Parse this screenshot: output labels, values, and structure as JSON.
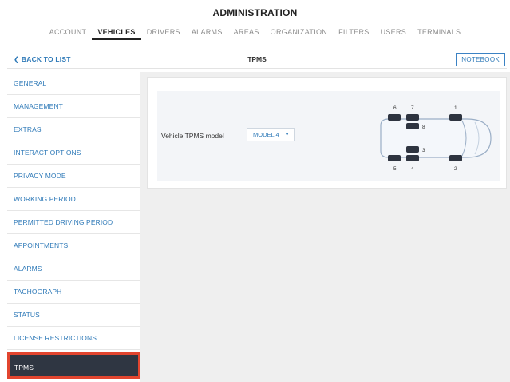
{
  "header": {
    "title": "ADMINISTRATION"
  },
  "nav": {
    "items": [
      "ACCOUNT",
      "VEHICLES",
      "DRIVERS",
      "ALARMS",
      "AREAS",
      "ORGANIZATION",
      "FILTERS",
      "USERS",
      "TERMINALS"
    ],
    "active": "VEHICLES"
  },
  "topbar": {
    "back_label": "BACK TO LIST",
    "title": "TPMS",
    "notebook_label": "NOTEBOOK"
  },
  "sidebar": {
    "items": [
      "GENERAL",
      "MANAGEMENT",
      "EXTRAS",
      "INTERACT OPTIONS",
      "PRIVACY MODE",
      "WORKING PERIOD",
      "PERMITTED DRIVING PERIOD",
      "APPOINTMENTS",
      "ALARMS",
      "TACHOGRAPH",
      "STATUS",
      "LICENSE RESTRICTIONS",
      "TPMS"
    ],
    "active": "TPMS"
  },
  "tpms": {
    "model_label": "Vehicle TPMS model",
    "model_value": "MODEL 4",
    "tire_labels": [
      "1",
      "2",
      "3",
      "4",
      "5",
      "6",
      "7",
      "8"
    ]
  },
  "colors": {
    "accent": "#2f7ab8",
    "active_bg": "#2f3642",
    "highlight": "#e2452f",
    "tire": "#2e3440"
  }
}
